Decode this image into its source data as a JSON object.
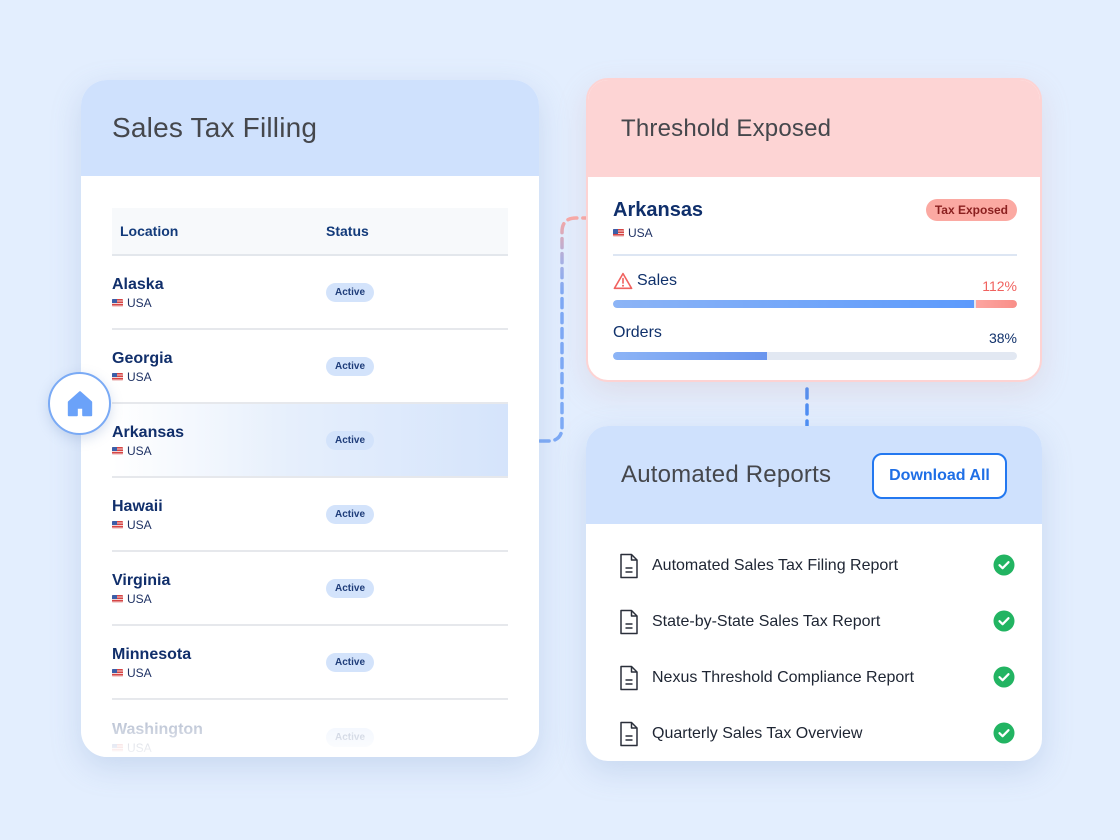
{
  "filing": {
    "title": "Sales Tax Filling",
    "columns": {
      "location": "Location",
      "status": "Status"
    },
    "rows": [
      {
        "state": "Alaska",
        "country": "USA",
        "status": "Active"
      },
      {
        "state": "Georgia",
        "country": "USA",
        "status": "Active"
      },
      {
        "state": "Arkansas",
        "country": "USA",
        "status": "Active",
        "selected": true
      },
      {
        "state": "Hawaii",
        "country": "USA",
        "status": "Active"
      },
      {
        "state": "Virginia",
        "country": "USA",
        "status": "Active"
      },
      {
        "state": "Minnesota",
        "country": "USA",
        "status": "Active"
      },
      {
        "state": "Washington",
        "country": "USA",
        "status": "Active"
      }
    ],
    "home_icon": "home-icon"
  },
  "threshold": {
    "title": "Threshold Exposed",
    "state": "Arkansas",
    "country": "USA",
    "badge": "Tax Exposed",
    "metrics": [
      {
        "label": "Sales",
        "value": "112%",
        "percent": 112,
        "warning": true
      },
      {
        "label": "Orders",
        "value": "38%",
        "percent": 38,
        "warning": false
      }
    ],
    "colors": {
      "warning": "#f0625f",
      "normal": "#10316b",
      "bar": "#5c9afc"
    }
  },
  "reports": {
    "title": "Automated Reports",
    "download_label": "Download All",
    "items": [
      {
        "name": "Automated Sales Tax Filing Report",
        "status": "complete"
      },
      {
        "name": "State-by-State Sales Tax Report",
        "status": "complete"
      },
      {
        "name": "Nexus Threshold Compliance Report",
        "status": "complete"
      },
      {
        "name": "Quarterly Sales Tax Overview",
        "status": "complete"
      }
    ],
    "check_color": "#22b462"
  }
}
